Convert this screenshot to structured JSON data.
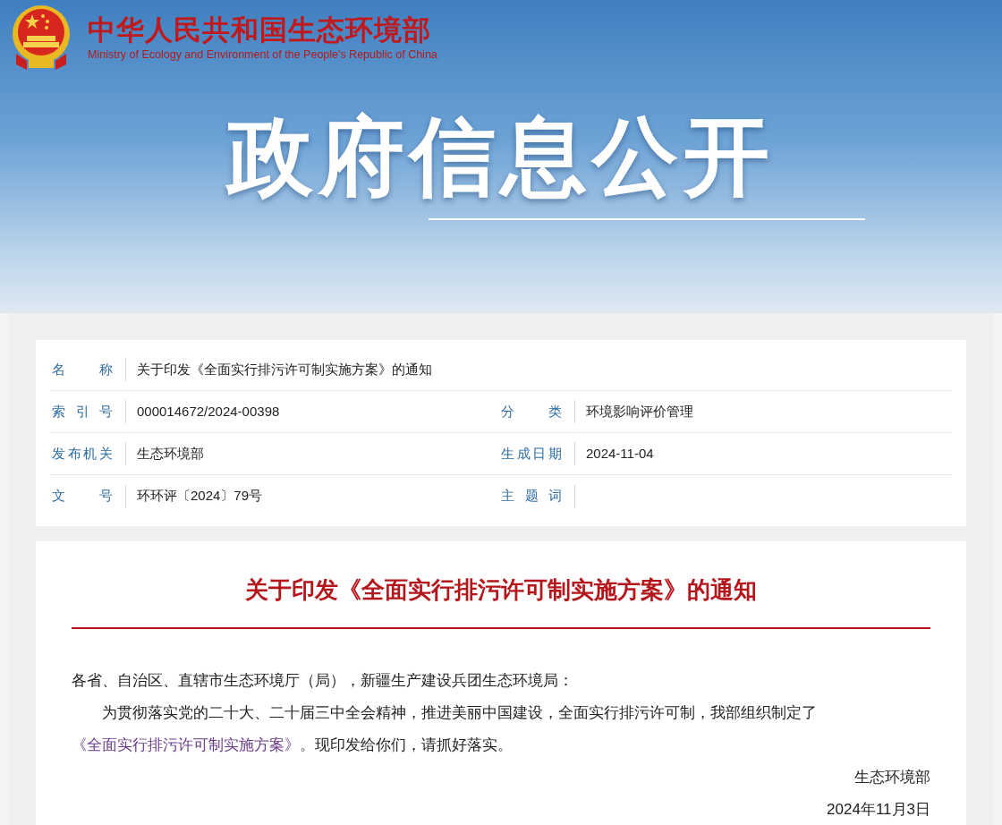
{
  "header": {
    "site_name": "中华人民共和国生态环境部",
    "site_name_en": "Ministry of Ecology and Environment of the People's Republic of China",
    "banner_title": "政府信息公开"
  },
  "info_table": {
    "rows": [
      {
        "cells": [
          {
            "label": "名称",
            "value": "关于印发《全面实行排污许可制实施方案》的通知"
          }
        ]
      },
      {
        "cells": [
          {
            "label": "索引号",
            "value": "000014672/2024-00398"
          },
          {
            "label": "分类",
            "value": "环境影响评价管理"
          }
        ]
      },
      {
        "cells": [
          {
            "label": "发布机关",
            "value": "生态环境部"
          },
          {
            "label": "生成日期",
            "value": "2024-11-04"
          }
        ]
      },
      {
        "cells": [
          {
            "label": "文号",
            "value": "环环评〔2024〕79号"
          },
          {
            "label": "主题词"
          }
        ]
      }
    ]
  },
  "article": {
    "title": "关于印发《全面实行排污许可制实施方案》的通知",
    "salutation": "各省、自治区、直辖市生态环境厅（局），新疆生产建设兵团生态环境局：",
    "body": {
      "before": "为贯彻落实党的二十大、二十届三中全会精神，推进美丽中国建设，全面实行排污许可制，我部组织制定了",
      "link": "《全面实行排污许可制实施方案》",
      "after": "。现印发给你们，请抓好落实。"
    },
    "signature": "生态环境部",
    "date": "2024年11月3日"
  }
}
